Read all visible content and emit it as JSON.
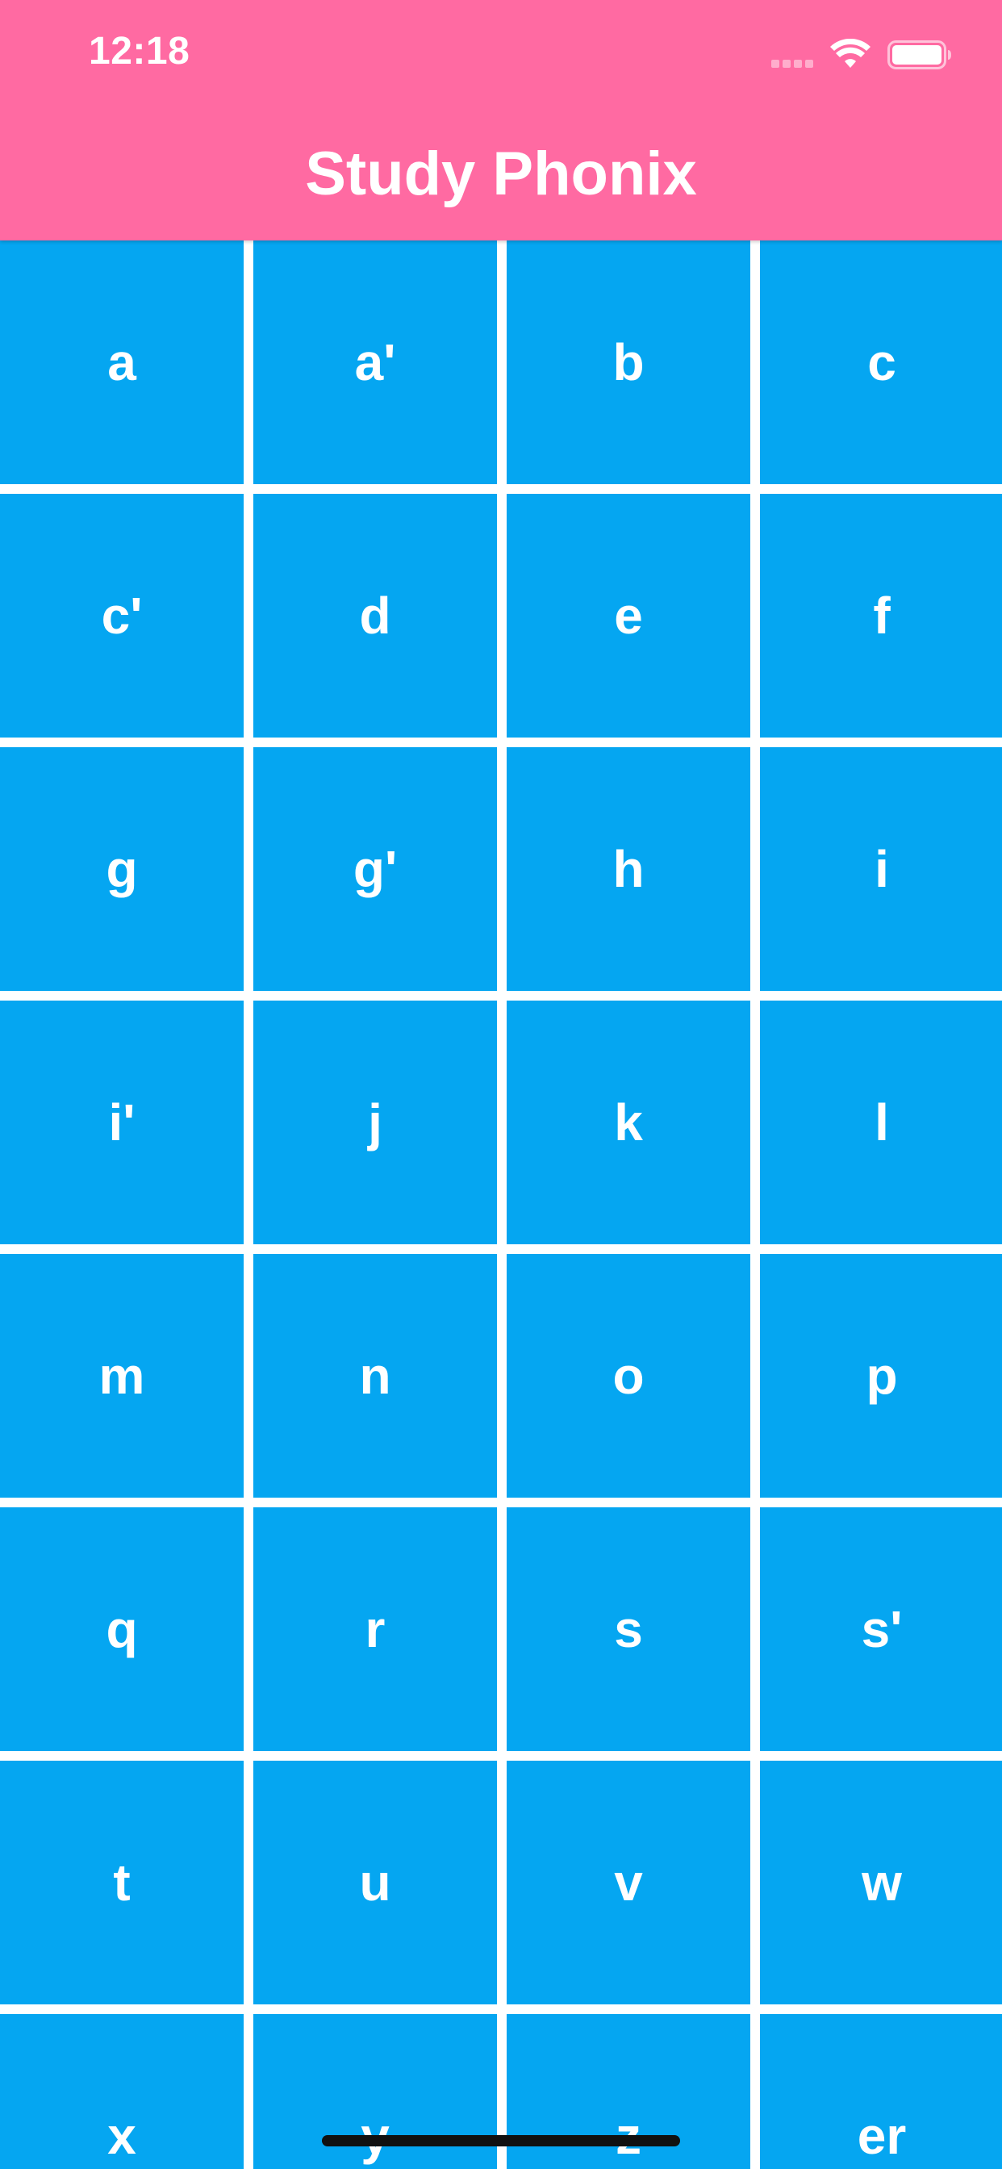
{
  "status_bar": {
    "time": "12:18"
  },
  "header": {
    "title": "Study Phonix",
    "background_color": "#FF6AA2"
  },
  "grid": {
    "tile_color": "#05A6F1",
    "tiles": [
      {
        "label": "a"
      },
      {
        "label": "a'"
      },
      {
        "label": "b"
      },
      {
        "label": "c"
      },
      {
        "label": "c'"
      },
      {
        "label": "d"
      },
      {
        "label": "e"
      },
      {
        "label": "f"
      },
      {
        "label": "g"
      },
      {
        "label": "g'"
      },
      {
        "label": "h"
      },
      {
        "label": "i"
      },
      {
        "label": "i'"
      },
      {
        "label": "j"
      },
      {
        "label": "k"
      },
      {
        "label": "l"
      },
      {
        "label": "m"
      },
      {
        "label": "n"
      },
      {
        "label": "o"
      },
      {
        "label": "p"
      },
      {
        "label": "q"
      },
      {
        "label": "r"
      },
      {
        "label": "s"
      },
      {
        "label": "s'"
      },
      {
        "label": "t"
      },
      {
        "label": "u"
      },
      {
        "label": "v"
      },
      {
        "label": "w"
      },
      {
        "label": "x"
      },
      {
        "label": "y"
      },
      {
        "label": "z"
      },
      {
        "label": "er"
      }
    ]
  },
  "icons": {
    "wifi": "wifi-icon",
    "battery": "battery-icon",
    "signal": "cellular-signal-icon"
  }
}
